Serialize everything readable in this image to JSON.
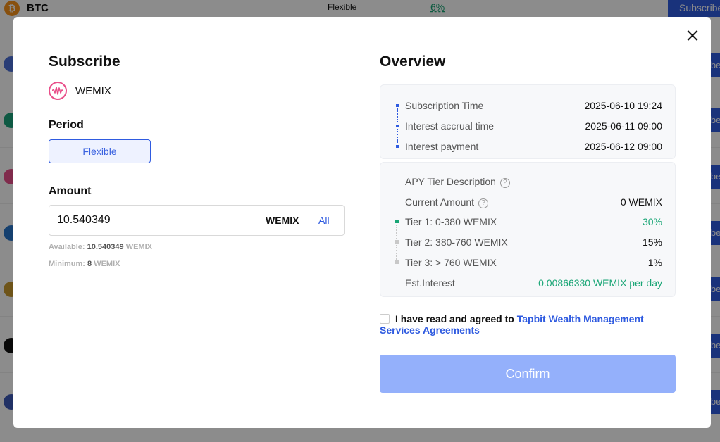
{
  "background": {
    "top_row": {
      "coin_symbol": "₿",
      "coin_name": "BTC",
      "period": "Flexible",
      "apy": "6%",
      "action": "Subscribe"
    },
    "row_button_fragment": "ibe",
    "colors": {
      "accent": "#2f5be0",
      "positive": "#18a575"
    }
  },
  "modal": {
    "close_icon": "close-icon",
    "left": {
      "title": "Subscribe",
      "coin": {
        "icon": "wemix-coin-icon",
        "name": "WEMIX"
      },
      "period_label": "Period",
      "period_option": "Flexible",
      "amount_label": "Amount",
      "amount_value": "10.540349",
      "amount_unit": "WEMIX",
      "amount_all": "All",
      "available_label": "Available:",
      "available_value": "10.540349",
      "available_unit": "WEMIX",
      "minimum_label": "Minimum:",
      "minimum_value": "8",
      "minimum_unit": "WEMIX"
    },
    "right": {
      "title": "Overview",
      "timeline": [
        {
          "label": "Subscription Time",
          "value": "2025-06-10 19:24"
        },
        {
          "label": "Interest accrual time",
          "value": "2025-06-11 09:00"
        },
        {
          "label": "Interest payment",
          "value": "2025-06-12 09:00"
        }
      ],
      "apy_tier_description": "APY Tier Description",
      "current_amount_label": "Current Amount",
      "current_amount_value": "0 WEMIX",
      "tiers": [
        {
          "label": "Tier 1: 0-380 WEMIX",
          "value": "30%",
          "color": "#18a575"
        },
        {
          "label": "Tier 2: 380-760 WEMIX",
          "value": "15%",
          "color": "#111111"
        },
        {
          "label": "Tier 3:  > 760 WEMIX",
          "value": "1%",
          "color": "#111111"
        }
      ],
      "est_interest_label": "Est.Interest",
      "est_interest_value": "0.00866330 WEMIX per day",
      "agree_text": "I have read and agreed to",
      "agree_link": "Tapbit Wealth Management Services Agreements",
      "confirm_label": "Confirm",
      "help_icon": "?"
    }
  }
}
